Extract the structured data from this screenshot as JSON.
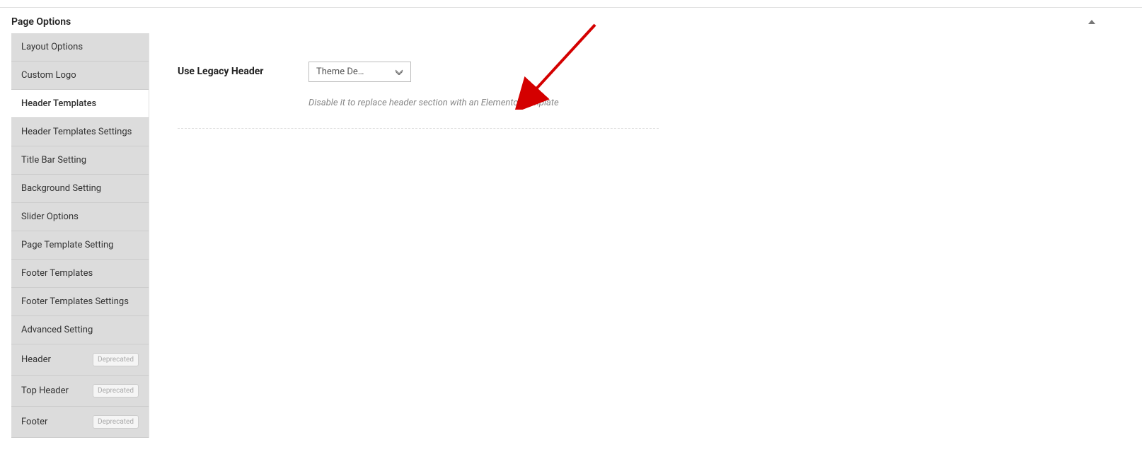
{
  "panel": {
    "title": "Page Options"
  },
  "sidebar": {
    "items": [
      {
        "label": "Layout Options",
        "active": false,
        "deprecated": false
      },
      {
        "label": "Custom Logo",
        "active": false,
        "deprecated": false
      },
      {
        "label": "Header Templates",
        "active": true,
        "deprecated": false
      },
      {
        "label": "Header Templates Settings",
        "active": false,
        "deprecated": false
      },
      {
        "label": "Title Bar Setting",
        "active": false,
        "deprecated": false
      },
      {
        "label": "Background Setting",
        "active": false,
        "deprecated": false
      },
      {
        "label": "Slider Options",
        "active": false,
        "deprecated": false
      },
      {
        "label": "Page Template Setting",
        "active": false,
        "deprecated": false
      },
      {
        "label": "Footer Templates",
        "active": false,
        "deprecated": false
      },
      {
        "label": "Footer Templates Settings",
        "active": false,
        "deprecated": false
      },
      {
        "label": "Advanced Setting",
        "active": false,
        "deprecated": false
      },
      {
        "label": "Header",
        "active": false,
        "deprecated": true
      },
      {
        "label": "Top Header",
        "active": false,
        "deprecated": true
      },
      {
        "label": "Footer",
        "active": false,
        "deprecated": true
      }
    ],
    "deprecated_label": "Deprecated"
  },
  "content": {
    "field_label": "Use Legacy Header",
    "select_value": "Theme De…",
    "help_text": "Disable it to replace header section with an Elementor template"
  }
}
